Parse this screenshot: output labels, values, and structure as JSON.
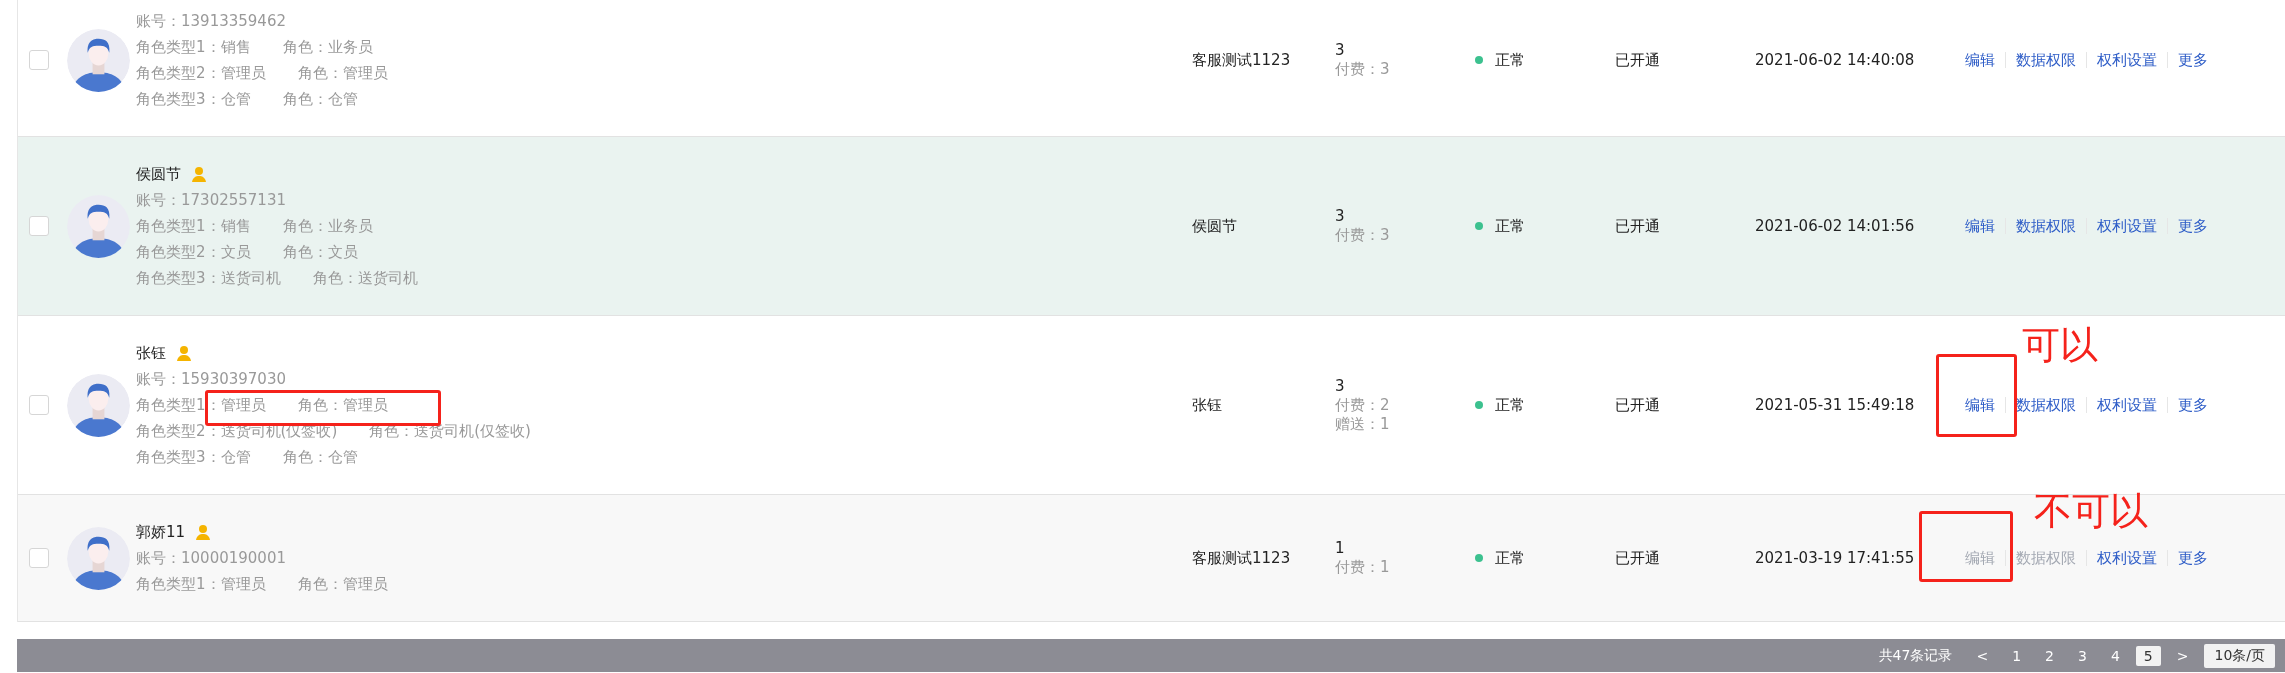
{
  "rows": [
    {
      "selected": false,
      "highlighted": false,
      "account": "账号：13913359462",
      "roles": [
        {
          "type": "角色类型1：销售",
          "role": "角色：业务员"
        },
        {
          "type": "角色类型2：管理员",
          "role": "角色：管理员"
        },
        {
          "type": "角色类型3：仓管",
          "role": "角色：仓管"
        }
      ],
      "creator": "客服测试1123",
      "count": "3",
      "count_details": [
        "付费：3"
      ],
      "status": "正常",
      "color": "#3cc18f",
      "opened": "已开通",
      "time": "2021-06-02 14:40:08",
      "actions": [
        {
          "label": "编辑",
          "disabled": false
        },
        {
          "label": "数据权限",
          "disabled": false
        },
        {
          "label": "权利设置",
          "disabled": false
        },
        {
          "label": "更多",
          "disabled": false
        }
      ]
    },
    {
      "selected": false,
      "highlighted": true,
      "name": "侯圆节",
      "badge": true,
      "account": "账号：17302557131",
      "roles": [
        {
          "type": "角色类型1：销售",
          "role": "角色：业务员"
        },
        {
          "type": "角色类型2：文员",
          "role": "角色：文员"
        },
        {
          "type": "角色类型3：送货司机",
          "role": "角色：送货司机"
        }
      ],
      "creator": "侯圆节",
      "count": "3",
      "count_details": [
        "付费：3"
      ],
      "status": "正常",
      "color": "#3cc18f",
      "opened": "已开通",
      "time": "2021-06-02 14:01:56",
      "actions": [
        {
          "label": "编辑",
          "disabled": false
        },
        {
          "label": "数据权限",
          "disabled": false
        },
        {
          "label": "权利设置",
          "disabled": false
        },
        {
          "label": "更多",
          "disabled": false
        }
      ]
    },
    {
      "selected": false,
      "highlighted": false,
      "name": "张钰",
      "badge": true,
      "account": "账号：15930397030",
      "roles": [
        {
          "type": "角色类型1：管理员",
          "role": "角色：管理员"
        },
        {
          "type": "角色类型2：送货司机(仅签收)",
          "role": "角色：送货司机(仅签收)"
        },
        {
          "type": "角色类型3：仓管",
          "role": "角色：仓管"
        }
      ],
      "creator": "张钰",
      "count": "3",
      "count_details": [
        "付费：2",
        "赠送：1"
      ],
      "status": "正常",
      "color": "#3cc18f",
      "opened": "已开通",
      "time": "2021-05-31 15:49:18",
      "actions": [
        {
          "label": "编辑",
          "disabled": false
        },
        {
          "label": "数据权限",
          "disabled": false
        },
        {
          "label": "权利设置",
          "disabled": false
        },
        {
          "label": "更多",
          "disabled": false
        }
      ]
    },
    {
      "selected": false,
      "highlighted": false,
      "name": "郭娇11",
      "badge": true,
      "account": "账号：10000190001",
      "roles": [
        {
          "type": "角色类型1：管理员",
          "role": "角色：管理员"
        }
      ],
      "creator": "客服测试1123",
      "count": "1",
      "count_details": [
        "付费：1"
      ],
      "status": "正常",
      "color": "#3cc18f",
      "opened": "已开通",
      "time": "2021-03-19 17:41:55",
      "actions": [
        {
          "label": "编辑",
          "disabled": true
        },
        {
          "label": "数据权限",
          "disabled": true
        },
        {
          "label": "权利设置",
          "disabled": false
        },
        {
          "label": "更多",
          "disabled": false
        }
      ]
    }
  ],
  "pagination": {
    "total": "共47条记录",
    "prev": "<",
    "pages": [
      {
        "label": "1",
        "selected": false
      },
      {
        "label": "2",
        "selected": false
      },
      {
        "label": "3",
        "selected": false
      },
      {
        "label": "4",
        "selected": false
      },
      {
        "label": "5",
        "selected": true
      }
    ],
    "next": ">",
    "page_size": "10条/页"
  },
  "annotations": [
    {
      "kind": "box"
    },
    {
      "kind": "box"
    },
    {
      "kind": "text",
      "text": "可以"
    },
    {
      "kind": "box"
    },
    {
      "kind": "text",
      "text": "不可以"
    }
  ]
}
